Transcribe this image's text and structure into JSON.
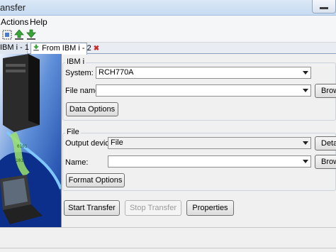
{
  "window": {
    "title": "ansfer"
  },
  "menu": {
    "actions": "Actions",
    "help": "Help"
  },
  "toolbar": {
    "icons": [
      "select-icon",
      "upload-icon",
      "download-icon"
    ]
  },
  "tabs": [
    {
      "label": "IBM i - 1",
      "icon": "upload-icon",
      "active": false
    },
    {
      "label": "From IBM i - 2",
      "icon": "download-icon",
      "active": true
    }
  ],
  "ibmi_group": {
    "title": "IBM i",
    "system_label": "System:",
    "system_value": "RCH770A",
    "filename_label": "File name:",
    "filename_value": "",
    "browse_label": "Brow",
    "data_options_label": "Data Options"
  },
  "file_group": {
    "title": "File",
    "output_device_label": "Output device:",
    "output_device_value": "File",
    "details_label": "Deta",
    "name_label": "Name:",
    "name_value": "",
    "browse_label": "Brow",
    "format_options_label": "Format Options"
  },
  "actions": {
    "start_transfer": "Start Transfer",
    "stop_transfer": "Stop Transfer",
    "properties": "Properties"
  },
  "colors": {
    "accent": "#1b4fb8",
    "close": "#c92a2a"
  }
}
